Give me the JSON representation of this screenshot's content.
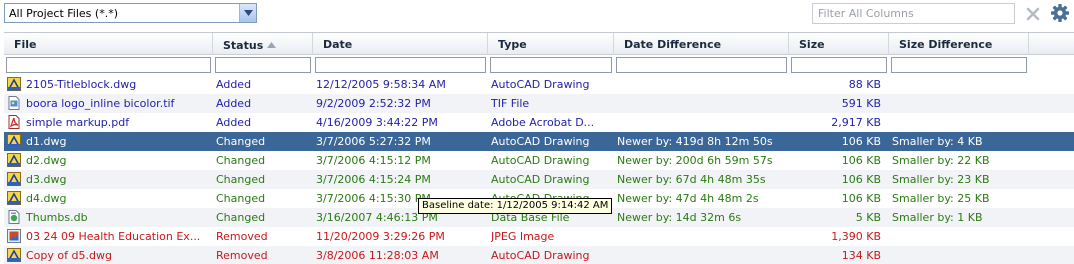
{
  "toolbar": {
    "file_filter": "All Project Files (*.*)",
    "filter_placeholder": "Filter All Columns"
  },
  "columns": [
    "File",
    "Status",
    "Date",
    "Type",
    "Date Difference",
    "Size",
    "Size Difference"
  ],
  "sorted_column": "Status",
  "rows": [
    {
      "icon": "dwg-file-icon",
      "file": "2105-Titleblock.dwg",
      "status": "Added",
      "date": "12/12/2005 9:58:34 AM",
      "type": "AutoCAD Drawing",
      "date_diff": "",
      "size": "88 KB",
      "size_diff": ""
    },
    {
      "icon": "tif-file-icon",
      "file": "boora logo_inline bicolor.tif",
      "status": "Added",
      "date": "9/2/2009 2:52:32 PM",
      "type": "TIF File",
      "date_diff": "",
      "size": "591 KB",
      "size_diff": ""
    },
    {
      "icon": "pdf-file-icon",
      "file": "simple markup.pdf",
      "status": "Added",
      "date": "4/16/2009 3:44:22 PM",
      "type": "Adobe Acrobat D...",
      "date_diff": "",
      "size": "2,917 KB",
      "size_diff": ""
    },
    {
      "icon": "dwg-file-icon",
      "file": "d1.dwg",
      "status": "Changed",
      "date": "3/7/2006 5:27:32 PM",
      "type": "AutoCAD Drawing",
      "date_diff": "Newer by: 419d 8h 12m 50s",
      "size": "106 KB",
      "size_diff": "Smaller by: 4 KB"
    },
    {
      "icon": "dwg-file-icon",
      "file": "d2.dwg",
      "status": "Changed",
      "date": "3/7/2006 4:15:12 PM",
      "type": "AutoCAD Drawing",
      "date_diff": "Newer by: 200d 6h 59m 57s",
      "size": "106 KB",
      "size_diff": "Smaller by: 22 KB"
    },
    {
      "icon": "dwg-file-icon",
      "file": "d3.dwg",
      "status": "Changed",
      "date": "3/7/2006 4:15:24 PM",
      "type": "AutoCAD Drawing",
      "date_diff": "Newer by: 67d 4h 48m 35s",
      "size": "106 KB",
      "size_diff": "Smaller by: 23 KB"
    },
    {
      "icon": "dwg-file-icon",
      "file": "d4.dwg",
      "status": "Changed",
      "date": "3/7/2006 4:15:30 PM",
      "type": "AutoCAD Drawing",
      "date_diff": "Newer by: 47d 4h 48m 2s",
      "size": "106 KB",
      "size_diff": "Smaller by: 25 KB"
    },
    {
      "icon": "db-file-icon",
      "file": "Thumbs.db",
      "status": "Changed",
      "date": "3/16/2007 4:46:13 PM",
      "type": "Data Base File",
      "date_diff": "Newer by: 14d 32m 6s",
      "size": "5 KB",
      "size_diff": "Smaller by: 1 KB"
    },
    {
      "icon": "jpeg-file-icon",
      "file": "03 24 09 Health Education Ex...",
      "status": "Removed",
      "date": "11/20/2009 3:29:26 PM",
      "type": "JPEG Image",
      "date_diff": "",
      "size": "1,390 KB",
      "size_diff": ""
    },
    {
      "icon": "dwg-file-icon",
      "file": "Copy of d5.dwg",
      "status": "Removed",
      "date": "3/8/2006 11:28:03 AM",
      "type": "AutoCAD Drawing",
      "date_diff": "",
      "size": "134 KB",
      "size_diff": ""
    }
  ],
  "selected_row": 3,
  "tooltip": "Baseline date: 1/12/2005 9:14:42 AM",
  "colors": {
    "added": "#1f1fa8",
    "changed": "#2b7a14",
    "removed": "#c8181a",
    "selected_row": "#3b6698",
    "tooltip_bg": "#ffffe1"
  }
}
